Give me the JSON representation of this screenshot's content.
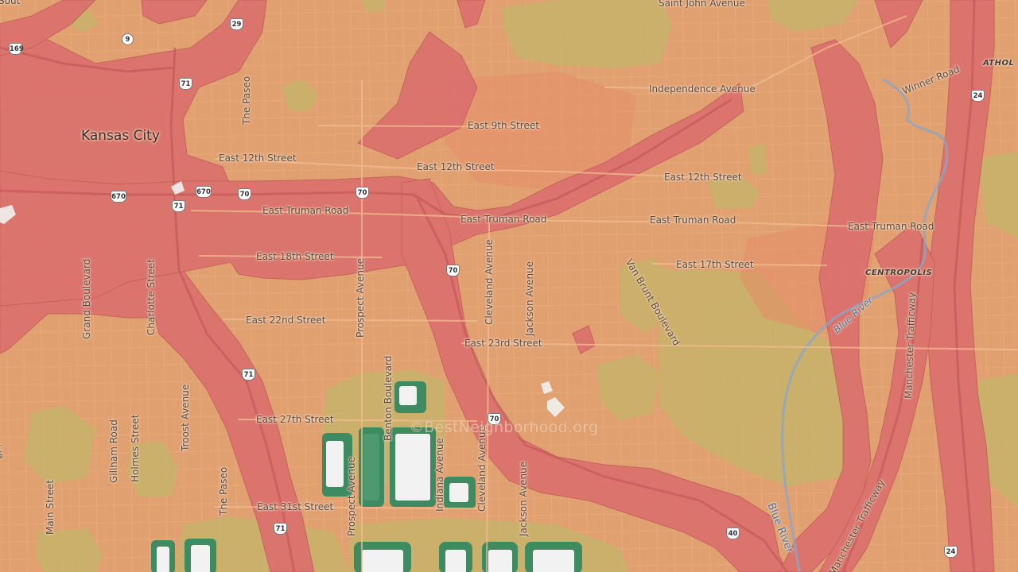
{
  "map": {
    "colors": {
      "base": "#E0A070",
      "high": "#DC6E6E",
      "medium": "#E58C68",
      "low": "#C9B16A",
      "park": "#B8BE74",
      "dark_green": "#3E8B62",
      "building_white": "#F2F2F2",
      "water": "#8AA6C8"
    },
    "watermark": "©BestNeighborhood.org",
    "labels": {
      "city": "Kansas City",
      "saint_john": "Saint John Avenue",
      "independence": "Independence Avenue",
      "e9": "East 9th Street",
      "winner": "Winner Road",
      "athol": "ATHOL",
      "paseo_n": "The Paseo",
      "e12_w": "East 12th Street",
      "e12_c": "East 12th Street",
      "e12_e": "East 12th Street",
      "truman_w": "East Truman Road",
      "truman_c": "East Truman Road",
      "truman_e": "East Truman Road",
      "truman_fe": "East Truman Road",
      "e18": "East 18th Street",
      "e17": "East 17th Street",
      "van_brunt": "Van Brunt Boulevard",
      "centropolis": "CENTROPOLIS",
      "grand": "Grand Boulevard",
      "charlotte": "Charlotte Street",
      "prospect_n": "Prospect Avenue",
      "cleveland_n": "Cleveland Avenue",
      "jackson_n": "Jackson Avenue",
      "e22": "East 22nd Street",
      "e23": "East 23rd Street",
      "blue_river_n": "Blue River",
      "manchester_n": "Manchester Trafficway",
      "benton": "Benton Boulevard",
      "e27": "East 27th Street",
      "gillham": "Gillham Road",
      "holmes": "Holmes Street",
      "troost": "Troost Avenue",
      "paseo_s": "The Paseo",
      "main": "Main Street",
      "e31": "East 31st Street",
      "prospect_s": "Prospect Avenue",
      "indiana": "Indiana Avenue",
      "cleveland_s": "Cleveland Avenue",
      "jackson_s": "Jackson Avenue",
      "blue_river_s": "Blue River",
      "manchester_s": "Manchester Trafficway",
      "edge_dr": "Drive",
      "edge_top": "Sout"
    },
    "shields": {
      "i169": "169",
      "h9": "9",
      "i29": "29",
      "i71_n": "71",
      "i670_w": "670",
      "i670_e": "670",
      "i70_a": "70",
      "i70_b": "70",
      "i70_c": "70",
      "i71_mid": "71",
      "i70_d": "70",
      "i71_low": "71",
      "i70_e": "70",
      "i71_s": "71",
      "us40": "40",
      "i24_n": "24",
      "i24_s": "24"
    }
  }
}
